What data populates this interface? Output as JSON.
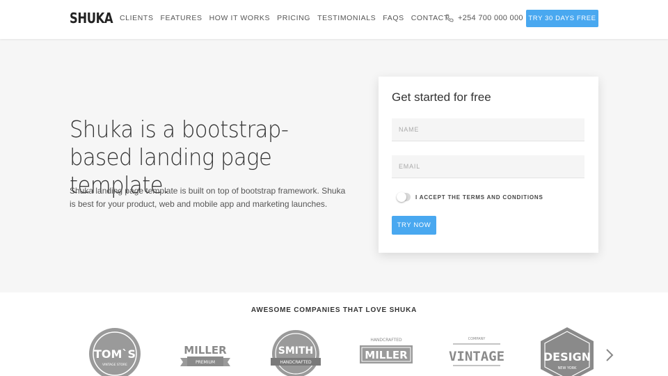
{
  "header": {
    "logo": "SHUKA",
    "nav": [
      "CLIENTS",
      "FEATURES",
      "HOW IT WORKS",
      "PRICING",
      "TESTIMONIALS",
      "FAQS",
      "CONTACT"
    ],
    "phone": "+254 700 000 000",
    "cta": "TRY 30 DAYS FREE",
    "phone_icon": "phone-icon"
  },
  "hero": {
    "title": "Shuka is a bootstrap-based landing page template.",
    "text": "Shuka landing page template is built on top of bootstrap framework. Shuka is best for your product, web and mobile app and marketing launches."
  },
  "form": {
    "title": "Get started for free",
    "name_placeholder": "NAME",
    "email_placeholder": "EMAIL",
    "terms_label": "I ACCEPT THE TERMS AND CONDITIONS",
    "terms_accepted": false,
    "submit": "TRY NOW"
  },
  "companies": {
    "title": "AWESOME COMPANIES THAT LOVE SHUKA",
    "logos": [
      {
        "main": "TOM`S",
        "sub": "VINTAGE STORE"
      },
      {
        "main": "MILLER",
        "sub": "PREMIUM"
      },
      {
        "main": "SMITH",
        "sub": "HANDCRAFTED"
      },
      {
        "main": "MILLER",
        "sub": "HANDCRAFTED"
      },
      {
        "main": "VINTAGE",
        "sub": "COMPANY"
      },
      {
        "main": "DESIGN",
        "sub": "NEW YORK"
      }
    ],
    "next_icon": "chevron-right-icon"
  },
  "colors": {
    "accent": "#49a8f0",
    "hero_bg": "#f6f6f6",
    "logo_gray": "#8a8a8a"
  }
}
